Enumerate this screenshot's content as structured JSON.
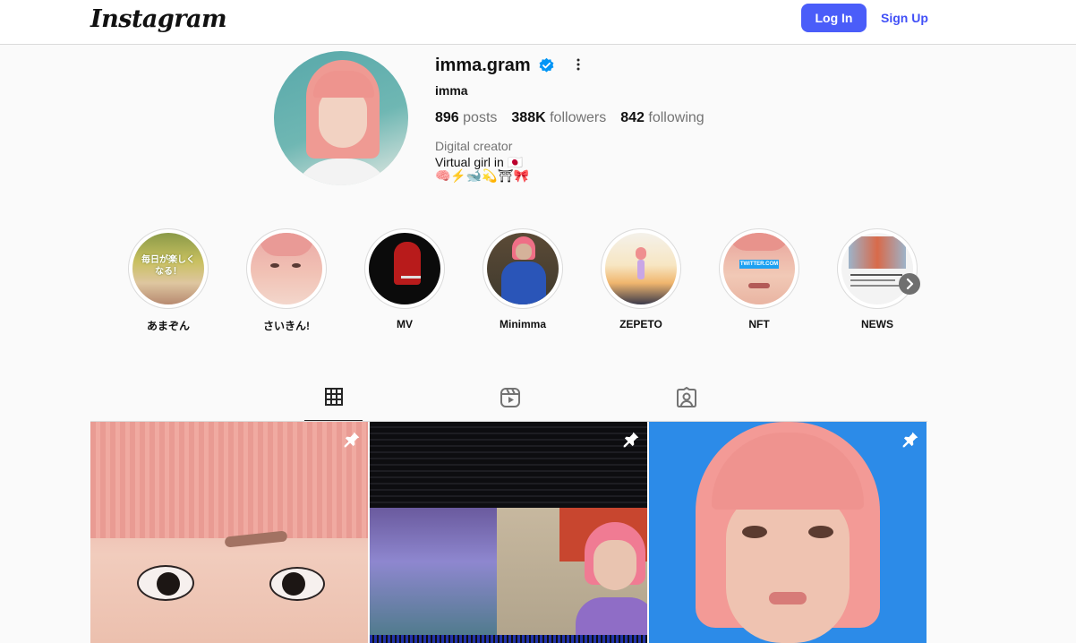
{
  "nav": {
    "logo_text": "Instagram",
    "login_label": "Log In",
    "signup_label": "Sign Up",
    "accent": "#4a5df9"
  },
  "profile": {
    "username": "imma.gram",
    "verified_icon": "verified-badge-icon",
    "more_icon": "more-options-icon",
    "full_name": "imma",
    "stats": {
      "posts_count": "896",
      "posts_label": "posts",
      "followers_count": "388K",
      "followers_label": "followers",
      "following_count": "842",
      "following_label": "following"
    },
    "category": "Digital creator",
    "bio_line1": "Virtual girl in 🇯🇵",
    "bio_line2": "🧠⚡️🐋💫⛩🎀"
  },
  "highlights": [
    {
      "label": "あまぞん"
    },
    {
      "label": "さいきん!"
    },
    {
      "label": "MV"
    },
    {
      "label": "Minimma"
    },
    {
      "label": "ZEPETO"
    },
    {
      "label": "NFT"
    },
    {
      "label": "NEWS"
    }
  ],
  "highlight_texts": {
    "amazon_overlay": "毎日が楽しくなる！",
    "nft_overlay": "TWITTER.COM"
  },
  "tabs": [
    {
      "name": "posts",
      "icon": "grid-icon",
      "active": true
    },
    {
      "name": "reels",
      "icon": "reels-icon",
      "active": false
    },
    {
      "name": "tagged",
      "icon": "tagged-icon",
      "active": false
    }
  ],
  "posts": [
    {
      "pinned": true,
      "icon": "pin-icon"
    },
    {
      "pinned": true,
      "icon": "pin-icon"
    },
    {
      "pinned": true,
      "icon": "pin-icon"
    }
  ]
}
